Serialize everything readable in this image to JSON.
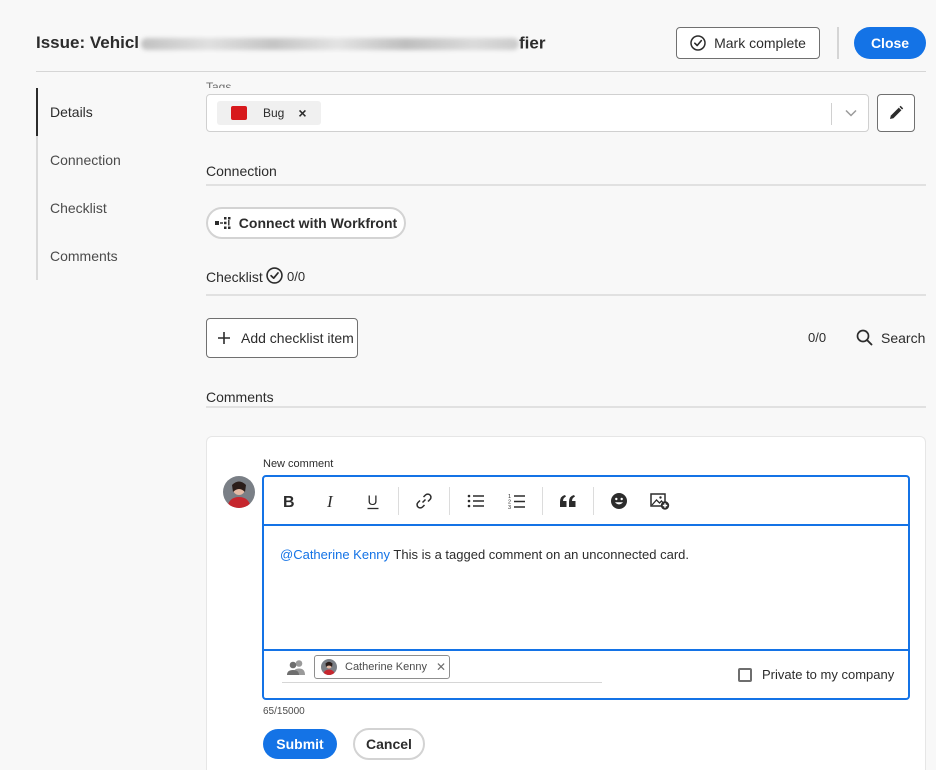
{
  "header": {
    "title_prefix": "Issue: Vehicl",
    "title_suffix": "fier",
    "mark_complete_label": "Mark complete",
    "close_label": "Close"
  },
  "sidenav": {
    "items": [
      {
        "label": "Details",
        "active": true
      },
      {
        "label": "Connection",
        "active": false
      },
      {
        "label": "Checklist",
        "active": false
      },
      {
        "label": "Comments",
        "active": false
      }
    ]
  },
  "tags": {
    "label": "Tags",
    "selected": [
      {
        "label": "Bug",
        "color": "#d7191c"
      }
    ]
  },
  "connection": {
    "heading": "Connection",
    "button_label": "Connect with Workfront"
  },
  "checklist": {
    "heading": "Checklist",
    "progress": "0/0",
    "add_label": "Add checklist item",
    "count": "0/0",
    "search_label": "Search"
  },
  "comments": {
    "heading": "Comments",
    "new_comment_label": "New comment",
    "mention": "@Catherine Kenny",
    "body": " This is a tagged comment on an unconnected card.",
    "tagged_user": "Catherine Kenny",
    "private_label": "Private to my company",
    "char_count": "65/15000",
    "submit_label": "Submit",
    "cancel_label": "Cancel"
  },
  "colors": {
    "accent": "#1473e6",
    "tag_bug": "#d7191c"
  }
}
